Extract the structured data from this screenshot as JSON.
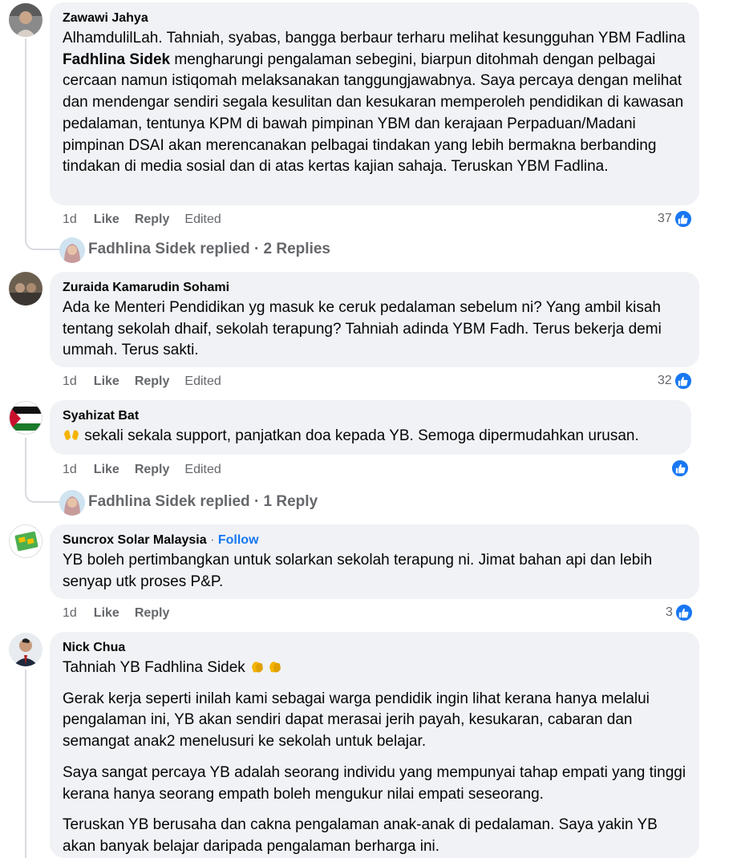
{
  "comments": [
    {
      "author": "Zawawi Jahya",
      "text_before": "AlhamdulilLah. Tahniah, syabas, bangga berbaur terharu melihat kesungguhan YBM Fadlina ",
      "mention": "Fadhlina Sidek",
      "text_after": " mengharungi pengalaman sebegini, biarpun ditohmah dengan pelbagai cercaan namun istiqomah melaksanakan tanggungjawabnya. Saya percaya dengan melihat dan mendengar sendiri segala kesulitan dan kesukaran memperoleh pendidikan di kawasan pedalaman, tentunya KPM di bawah pimpinan YBM dan kerajaan Perpaduan/Madani pimpinan DSAI akan merencanakan pelbagai tindakan yang lebih bermakna berbanding tindakan di media sosial dan di atas kertas kajian sahaja. Teruskan YBM Fadlina.",
      "time": "1d",
      "like": "Like",
      "reply": "Reply",
      "edited": "Edited",
      "reactions": "37",
      "replied": "Fadhlina Sidek replied · 2 Replies"
    },
    {
      "author": "Zuraida Kamarudin Sohami",
      "text": "Ada ke Menteri Pendidikan yg masuk ke ceruk pedalaman sebelum ni? Yang ambil kisah tentang sekolah dhaif, sekolah terapung? Tahniah adinda YBM Fadh. Terus bekerja demi ummah. Terus sakti.",
      "time": "1d",
      "like": "Like",
      "reply": "Reply",
      "edited": "Edited",
      "reactions": "32"
    },
    {
      "author": "Syahizat Bat",
      "emoji": "open-hands-emoji",
      "text": " sekali sekala support, panjatkan doa kepada YB. Semoga dipermudahkan urusan.",
      "time": "1d",
      "like": "Like",
      "reply": "Reply",
      "edited": "Edited",
      "reactions": "",
      "replied": "Fadhlina Sidek replied · 1 Reply"
    },
    {
      "author": "Suncrox Solar Malaysia",
      "follow_sep": " · ",
      "follow": "Follow",
      "text": "YB boleh pertimbangkan untuk solarkan sekolah terapung ni. Jimat bahan api dan lebih senyap utk proses P&P.",
      "time": "1d",
      "like": "Like",
      "reply": "Reply",
      "reactions": "3"
    },
    {
      "author": "Nick Chua",
      "line1": "Tahniah YB Fadhlina Sidek ",
      "emoji": "clapping-hands-emoji",
      "para1": "Gerak kerja seperti inilah kami sebagai warga pendidik ingin lihat kerana hanya melalui pengalaman ini, YB akan sendiri dapat merasai jerih payah, kesukaran, cabaran dan semangat anak2 menelusuri ke sekolah untuk belajar.",
      "para2": "Saya sangat percaya YB adalah seorang individu yang mempunyai tahap empati yang tinggi kerana hanya seorang empath boleh mengukur nilai empati seseorang.",
      "para3": "Teruskan YB berusaha dan cakna pengalaman anak-anak di pedalaman. Saya yakin YB akan banyak belajar daripada pengalaman berharga ini."
    }
  ],
  "colors": {
    "bubble": "#f0f2f5",
    "meta": "#65676b",
    "like_blue": "#1877f2"
  },
  "icons": {
    "like": "thumbs-up-icon"
  }
}
